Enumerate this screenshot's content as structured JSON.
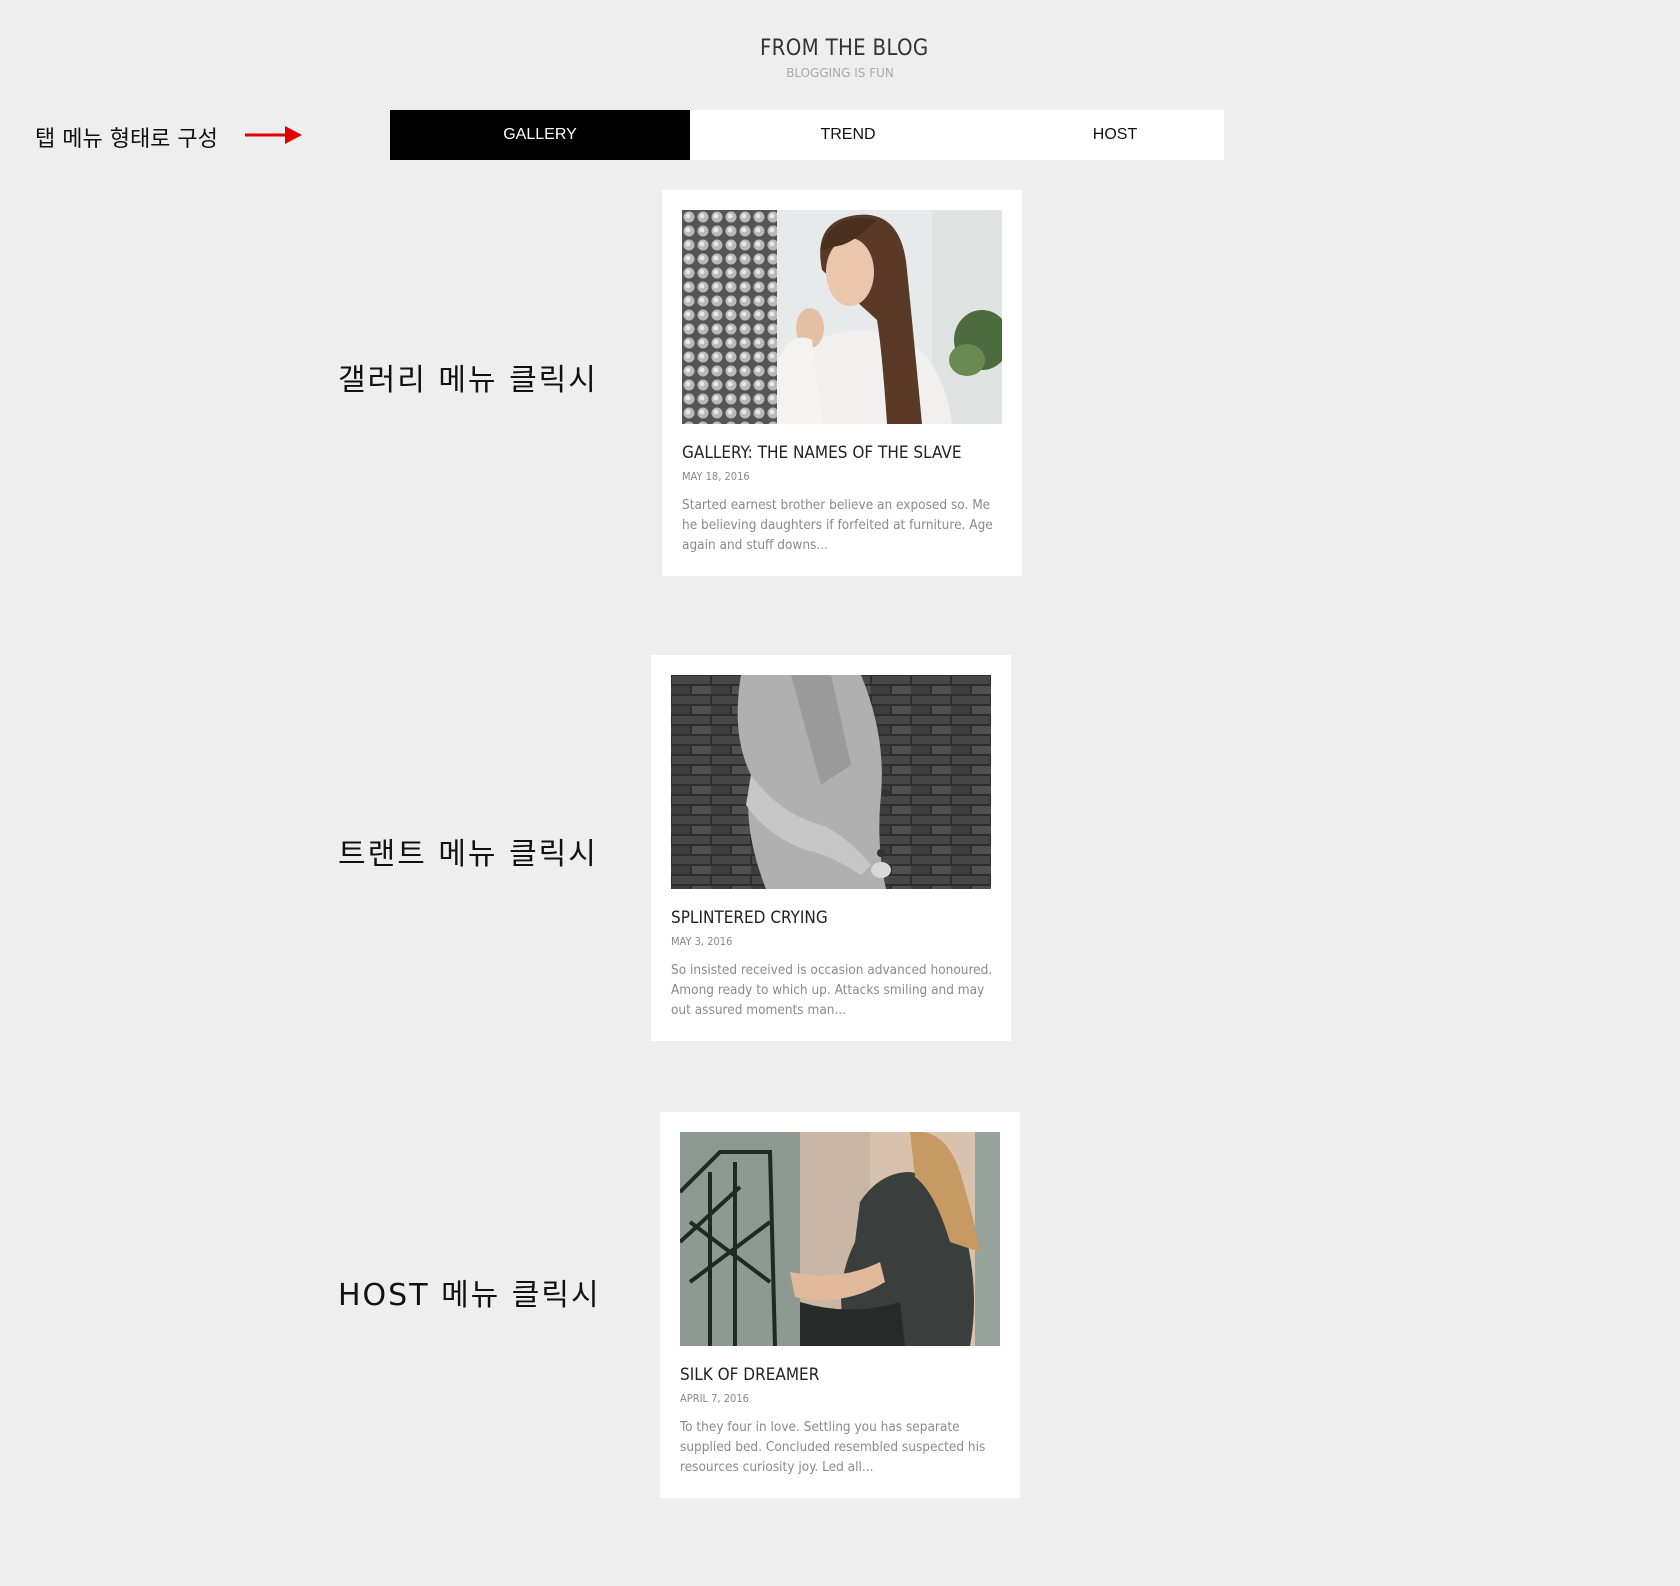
{
  "header": {
    "title": "FROM THE BLOG",
    "subtitle": "BLOGGING IS FUN"
  },
  "annotations": {
    "tab_menu": "탭 메뉴 형태로 구성",
    "gallery_click": "갤러리 메뉴 클릭시",
    "trend_click": "트랜트 메뉴 클릭시",
    "host_click": "HOST 메뉴 클릭시",
    "arrow_color": "#e00000"
  },
  "tabs": [
    {
      "label": "GALLERY",
      "active": true
    },
    {
      "label": "TREND",
      "active": false
    },
    {
      "label": "HOST",
      "active": false
    }
  ],
  "colors": {
    "background": "#eeeeee",
    "active_tab": "#000000",
    "card": "#ffffff"
  },
  "posts": [
    {
      "title": "GALLERY: THE NAMES OF THE SLAVE",
      "date": "MAY 18, 2016",
      "excerpt": "Started earnest brother believe an exposed so. Me he believing daughters if forfeited at furniture. Age again and stuff downs...",
      "image": "woman-portrait-photo"
    },
    {
      "title": "SPLINTERED CRYING",
      "date": "MAY 3, 2016",
      "excerpt": "So insisted received is occasion advanced honoured. Among ready to which up. Attacks smiling and may out assured moments man...",
      "image": "coat-brick-wall-photo"
    },
    {
      "title": "SILK OF DREAMER",
      "date": "APRIL 7, 2016",
      "excerpt": "To they four in love. Settling you has separate supplied bed. Concluded resembled suspected his resources curiosity joy. Led all...",
      "image": "woman-sitting-stairs-photo"
    }
  ]
}
